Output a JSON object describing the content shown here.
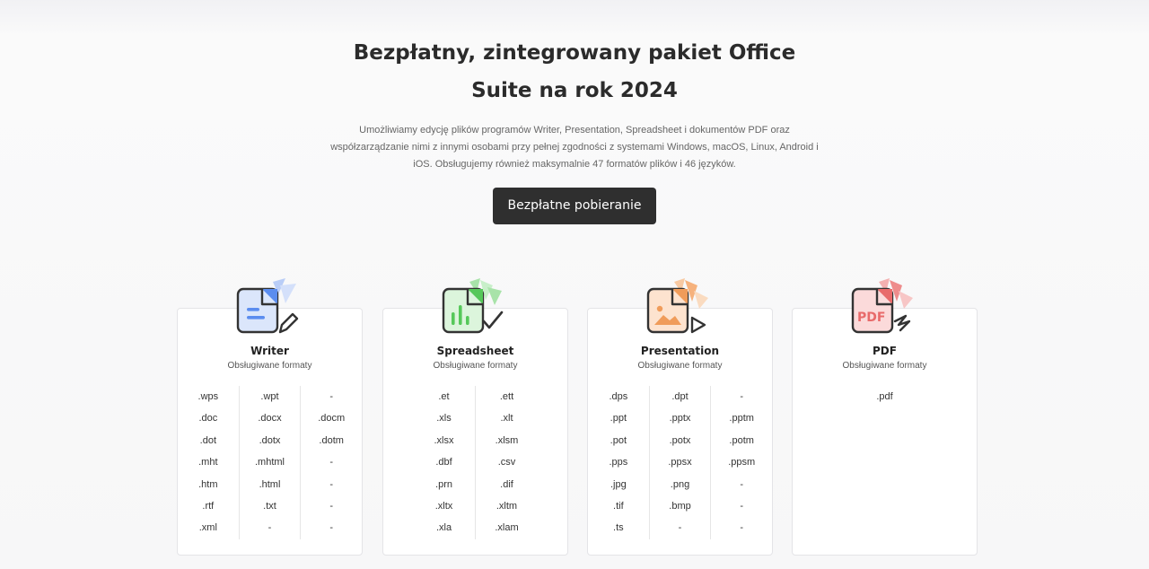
{
  "hero": {
    "title": "Bezpłatny, zintegrowany pakiet Office Suite na rok 2024",
    "description": "Umożliwiamy edycję plików programów Writer, Presentation, Spreadsheet i dokumentów PDF oraz współzarządzanie nimi z innymi osobami przy pełnej zgodności z systemami Windows, macOS, Linux, Android i iOS. Obsługujemy również maksymalnie 47 formatów plików i 46 języków.",
    "cta_label": "Bezpłatne pobieranie"
  },
  "colors": {
    "cta_bg": "#2f2f2f",
    "writer": "#5b8def",
    "spreadsheet": "#56c85a",
    "presentation": "#f09c5a",
    "pdf": "#e86a6a"
  },
  "cards": [
    {
      "name": "Writer",
      "subtitle": "Obsługiwane formaty",
      "icon": "writer-document-pen-icon",
      "columns": [
        [
          ".wps",
          ".doc",
          ".dot",
          ".mht",
          ".htm",
          ".rtf",
          ".xml"
        ],
        [
          ".wpt",
          ".docx",
          ".dotx",
          ".mhtml",
          ".html",
          ".txt",
          "-"
        ],
        [
          "-",
          ".docm",
          ".dotm",
          "-",
          "-",
          "-",
          "-"
        ]
      ]
    },
    {
      "name": "Spreadsheet",
      "subtitle": "Obsługiwane formaty",
      "icon": "spreadsheet-chart-check-icon",
      "columns": [
        [
          ".et",
          ".xls",
          ".xlsx",
          ".dbf",
          ".prn",
          ".xltx",
          ".xla"
        ],
        [
          ".ett",
          ".xlt",
          ".xlsm",
          ".csv",
          ".dif",
          ".xltm",
          ".xlam"
        ]
      ]
    },
    {
      "name": "Presentation",
      "subtitle": "Obsługiwane formaty",
      "icon": "presentation-image-play-icon",
      "columns": [
        [
          ".dps",
          ".ppt",
          ".pot",
          ".pps",
          ".jpg",
          ".tif",
          ".ts"
        ],
        [
          ".dpt",
          ".pptx",
          ".potx",
          ".ppsx",
          ".png",
          ".bmp",
          "-"
        ],
        [
          "-",
          ".pptm",
          ".potm",
          ".ppsm",
          "-",
          "-",
          "-"
        ]
      ]
    },
    {
      "name": "PDF",
      "subtitle": "Obsługiwane formaty",
      "icon": "pdf-document-sign-icon",
      "icon_text": "PDF",
      "columns": [
        [
          ".pdf"
        ]
      ]
    }
  ]
}
